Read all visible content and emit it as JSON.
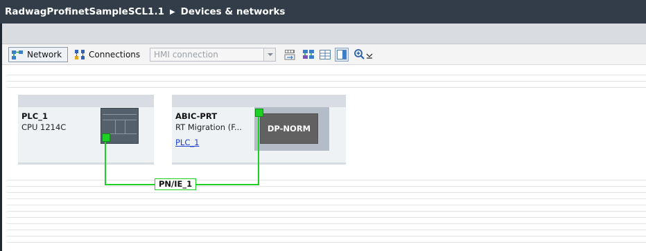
{
  "breadcrumb": {
    "project": "RadwagProfinetSampleSCL1.1",
    "separator": "▶",
    "page": "Devices & networks"
  },
  "toolbar": {
    "network_label": "Network",
    "connections_label": "Connections",
    "connection_type_placeholder": "HMI connection"
  },
  "devices": [
    {
      "name": "PLC_1",
      "type": "CPU 1214C"
    },
    {
      "name": "ABIC-PRT",
      "type": "RT Migration (F...",
      "link": "PLC_1",
      "module_label": "DP-NORM"
    }
  ],
  "network": {
    "label": "PN/IE_1"
  },
  "colors": {
    "title_bar": "#323d49",
    "profinet_green": "#1dd124",
    "device_frame": "#d7dde3",
    "module_dark": "#616161"
  }
}
